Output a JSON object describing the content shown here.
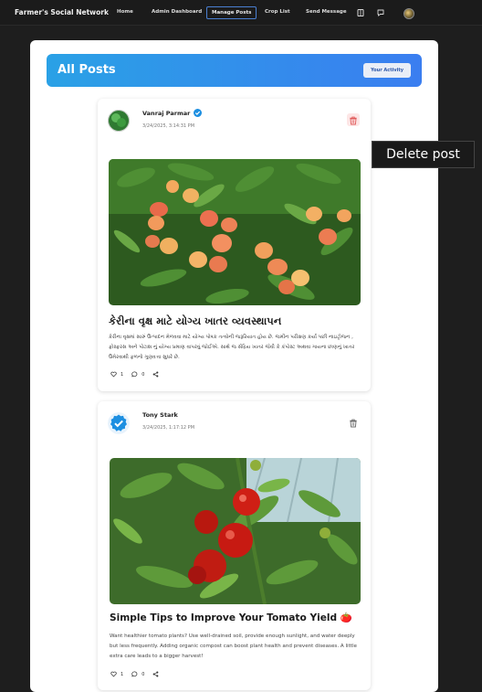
{
  "navbar": {
    "brand": "Farmer's Social Network",
    "items": [
      "Home",
      "Admin Dashboard",
      "Manage Posts",
      "Crop List",
      "Send Message"
    ],
    "active_item": "Manage Posts"
  },
  "header": {
    "title": "All Posts",
    "activity_button": "Your Activity"
  },
  "tooltip": "Delete post",
  "posts": [
    {
      "author": "Vanraj Parmar",
      "verified": true,
      "timestamp": "3/24/2025, 3:14:31 PM",
      "image": "mango-tree",
      "title": "કેરીના વૃક્ષ માટે યોગ્ય ખાતર વ્યવસ્થાપન",
      "body": "કેરીના વૃક્ષમાં સારું ઉત્પાદન મેળવવા માટે યોગ્ય પોષક તત્વોની જરૂરિયાત હોય છે. જમીન પરીક્ષણ કર્યા પછી નાઇટ્રોજન , ફોસ્ફરસ અને પોટાશ નું યોગ્ય પ્રમાણ વાપરવું જોઈએ. સાથે જ સેંદ્રિય ખાતર જેવી કે કંપોસ્ટ અથવા ગાયના છાણનું ખાતર ઉમેરવાથી ફળનો ગુણવત્તા સુધરે છે.",
      "likes": "1",
      "comments": "0",
      "delete_color": "#e05a5a"
    },
    {
      "author": "Tony Stark",
      "verified": true,
      "timestamp": "3/24/2025, 1:17:12 PM",
      "image": "tomato-plant",
      "title": "Simple Tips to Improve Your Tomato Yield 🍅",
      "body": "Want healthier tomato plants? Use well-drained soil, provide enough sunlight, and water deeply but less frequently. Adding organic compost can boost plant health and prevent diseases. A little extra care leads to a bigger harvest!",
      "likes": "1",
      "comments": "0",
      "delete_color": "#6a6a6a"
    }
  ],
  "colors": {
    "header_start": "#2aa1e6",
    "header_end": "#3a7ef0",
    "verified": "#1d8fe1",
    "page_bg": "#1e1e1e"
  }
}
